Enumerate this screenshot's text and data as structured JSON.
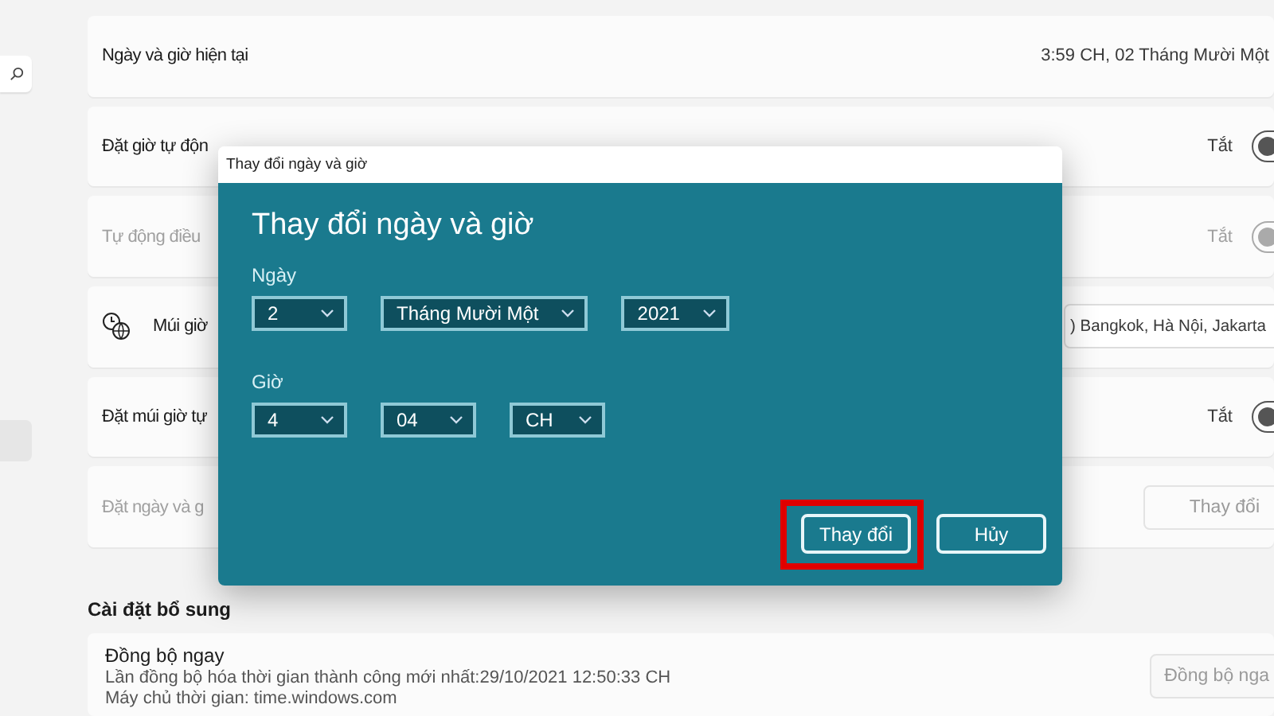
{
  "settings": {
    "rows": [
      {
        "kind": "value",
        "label": "Ngày và giờ hiện tại",
        "value": "3:59 CH, 02 Tháng Mười Một",
        "disabled": false
      },
      {
        "kind": "toggle",
        "label": "Đặt giờ tự độn",
        "value": "Tắt",
        "on": false,
        "disabled": false
      },
      {
        "kind": "toggle",
        "label": "Tự động điều",
        "value": "Tắt",
        "on": false,
        "disabled": true
      },
      {
        "kind": "dropdown",
        "label": "Múi giờ",
        "value": ") Bangkok, Hà Nội, Jakarta",
        "disabled": false
      },
      {
        "kind": "toggle",
        "label": "Đặt múi giờ tự",
        "value": "Tắt",
        "on": false,
        "disabled": false
      },
      {
        "kind": "button",
        "label": "Đặt ngày và g",
        "value": "Thay đổi",
        "disabled": true
      }
    ]
  },
  "additional": {
    "heading": "Cài đặt bổ sung",
    "title": "Đồng bộ ngay",
    "lines": [
      "Lần đồng bộ hóa thời gian thành công mới nhất:29/10/2021 12:50:33 CH",
      "Máy chủ thời gian: time.windows.com"
    ],
    "button": "Đồng bộ nga"
  },
  "dialog": {
    "window_title": "Thay đổi ngày và giờ",
    "heading": "Thay đổi ngày và giờ",
    "groups": [
      {
        "label": "Ngày",
        "fields": [
          "2",
          "Tháng Mười Một",
          "2021"
        ]
      },
      {
        "label": "Giờ",
        "fields": [
          "4",
          "04",
          "CH"
        ]
      }
    ],
    "buttons": [
      {
        "label": "Thay đổi",
        "highlighted": true
      },
      {
        "label": "Hủy",
        "highlighted": false
      }
    ]
  }
}
